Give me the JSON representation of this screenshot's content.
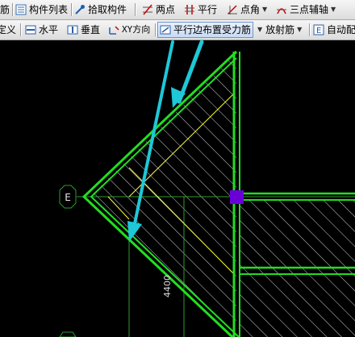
{
  "toolbar1": {
    "items": [
      {
        "label": "筋"
      },
      {
        "label": "构件列表"
      },
      {
        "label": "拾取构件"
      },
      {
        "label": "两点"
      },
      {
        "label": "平行"
      },
      {
        "label": "点角"
      },
      {
        "label": "三点辅轴"
      }
    ]
  },
  "toolbar2": {
    "items": [
      {
        "label": "定义"
      },
      {
        "label": "水平"
      },
      {
        "label": "垂直"
      },
      {
        "label": "XY方向"
      },
      {
        "label": "平行边布置受力筋"
      },
      {
        "label": "放射筋"
      },
      {
        "label": "自动配"
      }
    ]
  },
  "canvas": {
    "axis_label": "E",
    "dimension_text": "4400"
  },
  "colors": {
    "slab_edge": "#22dd22",
    "hatch": "#e8e8e8",
    "axis": "#2e9d2e",
    "rebar": "#ffff44",
    "arrow": "#1ec8d8",
    "grip": "#6a00d8"
  }
}
